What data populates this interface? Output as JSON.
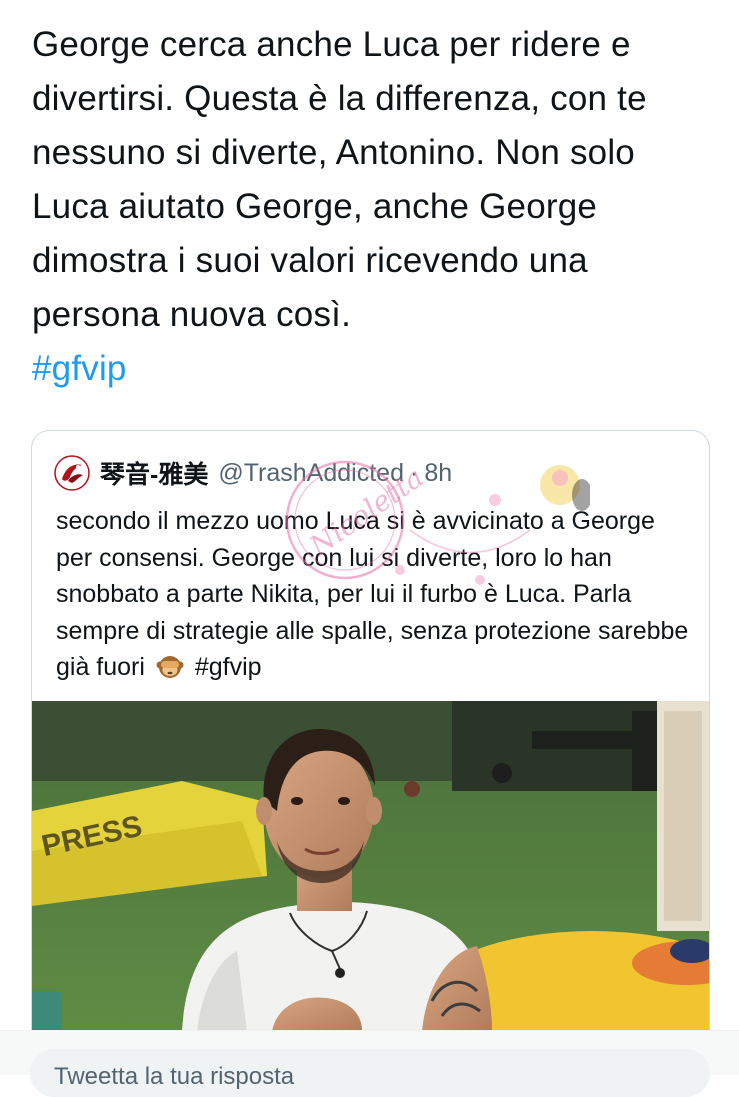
{
  "tweet": {
    "text": "George cerca anche Luca per ridere e divertirsi. Questa è la differenza, con te nessuno si diverte, Antonino. Non solo Luca aiutato George, anche George dimostra i suoi valori ricevendo una persona nuova così.",
    "hashtag": "#gfvip"
  },
  "quote": {
    "display_name": "琴音-雅美",
    "handle": "@TrashAddicted",
    "separator": "·",
    "time": "8h",
    "text_before_emoji": "secondo il mezzo uomo Luca si è avvicinato a George per consensi. George con lui si diverte, loro lo han snobbato a parte Nikita, per lui il furbo è Luca. Parla sempre di strategie alle spalle, senza protezione sarebbe già fuori",
    "emoji": "see-no-evil-monkey",
    "hashtag": "#gfvip"
  },
  "reply": {
    "placeholder": "Tweetta la tua risposta"
  },
  "watermark": {
    "text": "Nicoletta"
  },
  "colors": {
    "link": "#1d9bf0",
    "text": "#0f1419",
    "secondary": "#536471",
    "border": "#cfd9de"
  }
}
